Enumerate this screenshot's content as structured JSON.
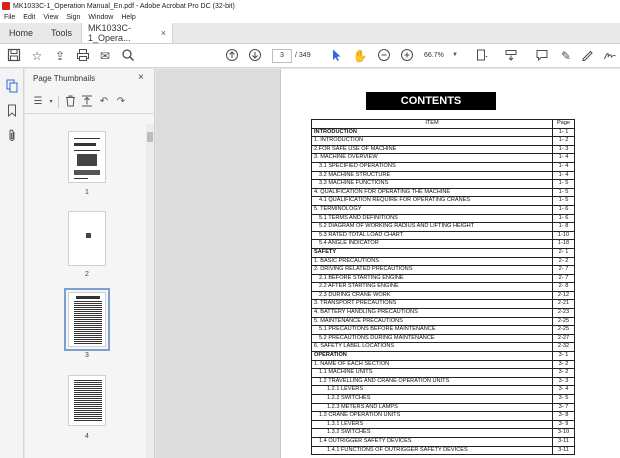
{
  "window": {
    "title": "MK1033C-1_Operation Manual_En.pdf - Adobe Acrobat Pro DC (32-bit)"
  },
  "menu": [
    "File",
    "Edit",
    "View",
    "Sign",
    "Window",
    "Help"
  ],
  "tabs": {
    "home": "Home",
    "tools": "Tools",
    "document": "MK1033C-1_Opera...",
    "close": "×"
  },
  "toolbar": {
    "current_page": "3",
    "page_separator": "/",
    "total_pages": "349",
    "zoom": "66.7%"
  },
  "thumbnail_panel": {
    "title": "Page Thumbnails",
    "close": "×",
    "thumbnails": [
      {
        "label": "1"
      },
      {
        "label": "2"
      },
      {
        "label": "3",
        "selected": true
      },
      {
        "label": "4"
      }
    ]
  },
  "document": {
    "heading": "CONTENTS",
    "table_headers": [
      "ITEM",
      "Page"
    ],
    "rows": [
      {
        "item": "INTRODUCTION",
        "page": "1- 1",
        "level": 0,
        "section": true
      },
      {
        "item": "1. INTRODUCTION",
        "page": "1- 2",
        "level": 0
      },
      {
        "item": "2.FOR SAFE USE OF MACHINE",
        "page": "1- 3",
        "level": 0
      },
      {
        "item": "3. MACHINE OVERVIEW",
        "page": "1- 4",
        "level": 0
      },
      {
        "item": "3.1 SPECIFIED OPERATIONS",
        "page": "1- 4",
        "level": 1
      },
      {
        "item": "3.2 MACHINE STRUCTURE",
        "page": "1- 4",
        "level": 1
      },
      {
        "item": "3.3 MACHINE FUNCTIONS",
        "page": "1- 5",
        "level": 1
      },
      {
        "item": "4. QUALIFICATION FOR OPERATING THE MACHINE",
        "page": "1- 5",
        "level": 0
      },
      {
        "item": "4.1 QUALIFICATION REQUIRE FOR OPERATING CRANES",
        "page": "1- 5",
        "level": 1
      },
      {
        "item": "5. TERMINOLOGY",
        "page": "1- 6",
        "level": 0
      },
      {
        "item": "5.1 TERMS AND DEFINITIONS",
        "page": "1- 6",
        "level": 1
      },
      {
        "item": "5.2 DIAGRAM OF WORKING RADIUS AND LIFTING HEIGHT",
        "page": "1- 8",
        "level": 1
      },
      {
        "item": "5.3 RATED TOTAL LOAD CHART",
        "page": "1-10",
        "level": 1
      },
      {
        "item": "5.4 ANGLE INDICATOR",
        "page": "1-18",
        "level": 1
      },
      {
        "item": "SAFETY",
        "page": "2- 1",
        "level": 0,
        "section": true
      },
      {
        "item": "1. BASIC PRECAUTIONS",
        "page": "2- 2",
        "level": 0
      },
      {
        "item": "2. DRIVING RELATED PRECAUTIONS",
        "page": "2- 7",
        "level": 0
      },
      {
        "item": "2.1 BEFORE STARTING ENGINE",
        "page": "2- 7",
        "level": 1
      },
      {
        "item": "2.2 AFTER STARTING ENGINE",
        "page": "2- 8",
        "level": 1
      },
      {
        "item": "2.3 DURING CRANE WORK",
        "page": "2-12",
        "level": 1
      },
      {
        "item": "3. TRANSPORT PRECAUTIONS",
        "page": "2-21",
        "level": 0
      },
      {
        "item": "4. BATTERY HANDLING PRECAUTIONS",
        "page": "2-23",
        "level": 0
      },
      {
        "item": "5. MAINTENANCE PRECAUTIONS",
        "page": "2-25",
        "level": 0
      },
      {
        "item": "5.1 PRECAUTIONS BEFORE MAINTENANCE",
        "page": "2-25",
        "level": 1
      },
      {
        "item": "5.2 PRECAUTIONS DURING MAINTENANCE",
        "page": "2-27",
        "level": 1
      },
      {
        "item": "6. SAFETY LABEL LOCATIONS",
        "page": "2-32",
        "level": 0
      },
      {
        "item": "OPERATION",
        "page": "3- 1",
        "level": 0,
        "section": true
      },
      {
        "item": "1. NAME OF EACH SECTION",
        "page": "3- 2",
        "level": 0
      },
      {
        "item": "1.1 MACHINE UNITS",
        "page": "3- 2",
        "level": 1
      },
      {
        "item": "1.2 TRAVELLING AND CRANE OPERATION UNITS",
        "page": "3- 3",
        "level": 1
      },
      {
        "item": "1.2.1 LEVERS",
        "page": "3- 4",
        "level": 2
      },
      {
        "item": "1.2.2 SWITCHES",
        "page": "3- 5",
        "level": 2
      },
      {
        "item": "1.2.3 METERS AND LAMPS",
        "page": "3- 7",
        "level": 2
      },
      {
        "item": "1.3 CRANE OPERATION UNITS",
        "page": "3- 8",
        "level": 1
      },
      {
        "item": "1.3.1 LEVERS",
        "page": "3- 9",
        "level": 2
      },
      {
        "item": "1.3.2 SWITCHES",
        "page": "3-10",
        "level": 2
      },
      {
        "item": "1.4 OUTRIGGER SAFETY DEVICES",
        "page": "3-11",
        "level": 1
      },
      {
        "item": "1.4.1 FUNCTIONS OF OUTRIGGER SAFETY DEVICES",
        "page": "3-11",
        "level": 2
      }
    ]
  },
  "colors": {
    "accent_blue": "#2d6fd1",
    "selection": "#7b9fd0",
    "acrobat_red": "#d4241c"
  }
}
